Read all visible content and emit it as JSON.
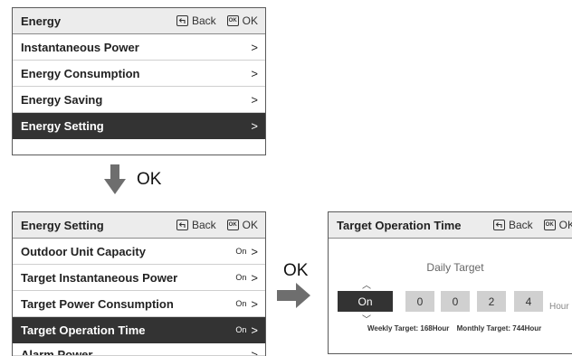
{
  "panel1": {
    "title": "Energy",
    "back_label": "Back",
    "ok_label": "OK",
    "ok_icon_text": "OK",
    "items": [
      {
        "label": "Instantaneous Power",
        "chevron": ">"
      },
      {
        "label": "Energy Consumption",
        "chevron": ">"
      },
      {
        "label": "Energy Saving",
        "chevron": ">"
      },
      {
        "label": "Energy Setting",
        "chevron": ">",
        "selected": true
      }
    ]
  },
  "flow": {
    "down_label": "OK",
    "right_label": "OK"
  },
  "panel2": {
    "title": "Energy Setting",
    "back_label": "Back",
    "ok_label": "OK",
    "ok_icon_text": "OK",
    "items": [
      {
        "label": "Outdoor Unit Capacity",
        "value": "On",
        "chevron": ">"
      },
      {
        "label": "Target Instantaneous Power",
        "value": "On",
        "chevron": ">"
      },
      {
        "label": "Target Power Consumption",
        "value": "On",
        "chevron": ">"
      },
      {
        "label": "Target Operation Time",
        "value": "On",
        "chevron": ">",
        "selected": true
      },
      {
        "label": "Alarm Power",
        "value": "",
        "chevron": ">"
      }
    ]
  },
  "panel3": {
    "title": "Target Operation Time",
    "back_label": "Back",
    "ok_label": "OK",
    "ok_icon_text": "OK",
    "daily_target_label": "Daily Target",
    "toggle_value": "On",
    "digits": [
      "0",
      "0",
      "2",
      "4"
    ],
    "unit": "Hour",
    "weekly_target": "Weekly Target: 168Hour",
    "monthly_target": "Monthly Target: 744Hour",
    "up_glyph": "︿",
    "down_glyph": "﹀"
  },
  "colors": {
    "selected_bg": "#333333",
    "header_bg": "#ececec",
    "arrow": "#6e6e6e",
    "digit_bg": "#d0d0d0"
  }
}
